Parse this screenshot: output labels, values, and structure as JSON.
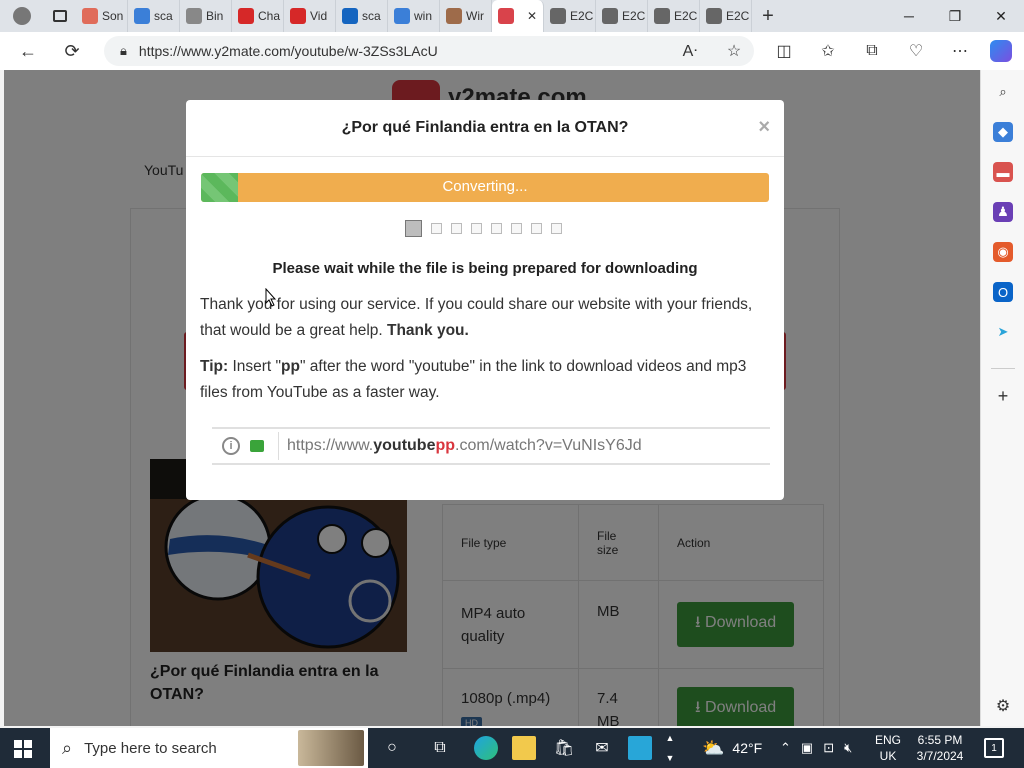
{
  "browser": {
    "tabs": [
      {
        "label": "Son",
        "color": "#e06c5a"
      },
      {
        "label": "sca",
        "color": "#3b7fd8"
      },
      {
        "label": "Bin",
        "color": "#888888"
      },
      {
        "label": "Cha",
        "color": "#d62828"
      },
      {
        "label": "Vid",
        "color": "#d62828"
      },
      {
        "label": "sca",
        "color": "#1565c0"
      },
      {
        "label": "win",
        "color": "#3b7fd8"
      },
      {
        "label": "Wir",
        "color": "#9e6b4a"
      },
      {
        "label": "",
        "color": "#d9434b",
        "active": true
      },
      {
        "label": "E2C",
        "color": "#666666"
      },
      {
        "label": "E2C",
        "color": "#666666"
      },
      {
        "label": "E2C",
        "color": "#666666"
      },
      {
        "label": "E2C",
        "color": "#666666"
      }
    ],
    "url": "https://www.y2mate.com/youtube/w-3ZSs3LAcU"
  },
  "page": {
    "nav_link": "YouTu",
    "logo_text": "y2mate.com",
    "video_title": "¿Por qué Finlandia entra en la OTAN?",
    "table": {
      "headers": [
        "File type",
        "File size",
        "Action"
      ],
      "rows": [
        {
          "type": "MP4 auto quality",
          "size": "MB",
          "action": "Download"
        },
        {
          "type": "1080p (.mp4)",
          "badge": "HD",
          "size": "7.4 MB",
          "action": "Download"
        }
      ]
    }
  },
  "modal": {
    "title": "¿Por qué Finlandia entra en la OTAN?",
    "close": "×",
    "progress_label": "Converting...",
    "progress_fraction": 0.065,
    "wait_text": "Please wait while the file is being prepared for downloading",
    "thanks_text": "Thank you for using our service. If you could share our website with your friends, that would be a great help.",
    "thanks_bold": "Thank you.",
    "tip_label": "Tip:",
    "tip_pre": "Insert \"",
    "tip_pp": "pp",
    "tip_post": "\" after the word \"youtube\" in the link to download videos and mp3 files from YouTube as a faster way.",
    "example_url_a": "https://www.",
    "example_url_b": "youtube",
    "example_url_c": "pp",
    "example_url_d": ".com/watch?v=VuNIsY6Jd"
  },
  "taskbar": {
    "search_placeholder": "Type here to search",
    "weather": "42°F",
    "lang_top": "ENG",
    "lang_bottom": "UK",
    "time": "6:55 PM",
    "date": "3/7/2024",
    "notif_count": "1"
  }
}
